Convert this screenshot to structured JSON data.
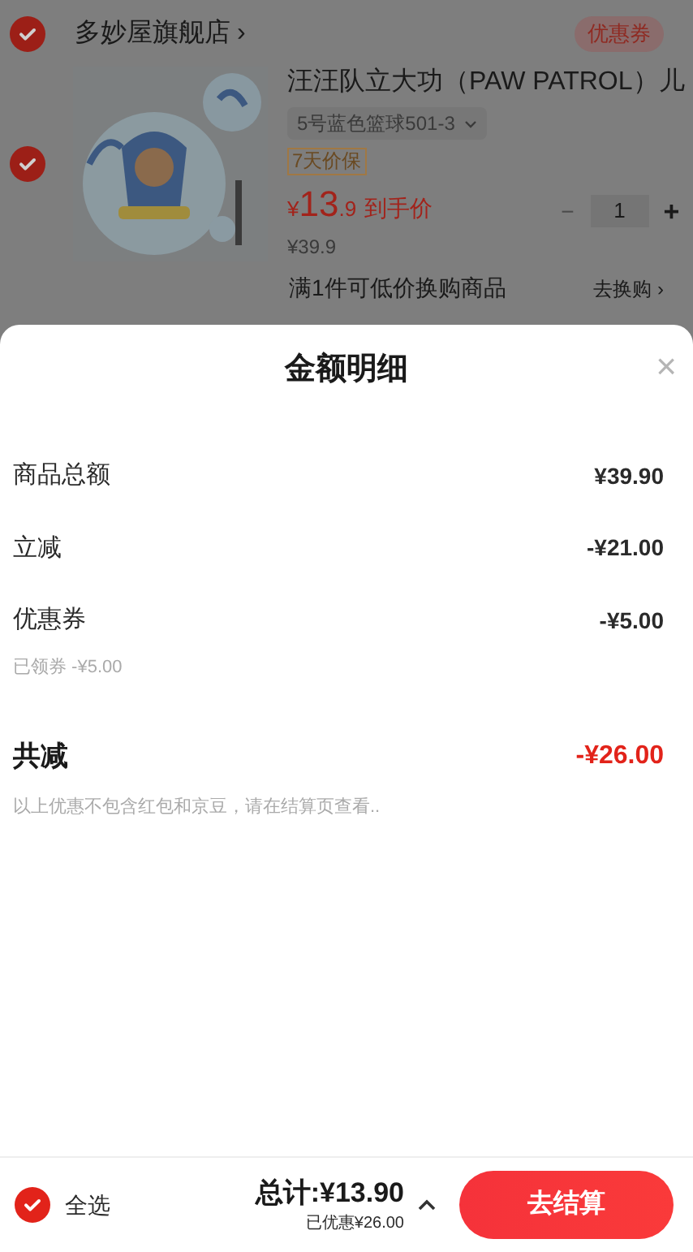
{
  "store": {
    "checked": true,
    "name": "多妙屋旗舰店",
    "chevron": "›",
    "coupon_badge": "优惠券"
  },
  "product": {
    "checked": true,
    "title": "汪汪队立大功（PAW PATROL）儿",
    "variant": "5号蓝色篮球501-3",
    "badge": "7天价保",
    "price_symbol": "¥",
    "price_int": "13",
    "price_dec": ".9",
    "price_label": "到手价",
    "original_price": "¥39.9",
    "minus": "−",
    "quantity": "1",
    "plus": "+"
  },
  "promo": {
    "text": "满1件可低价换购商品",
    "link": "去换购 ›"
  },
  "sheet": {
    "title": "金额明细",
    "close": "×",
    "rows": [
      {
        "kind": "item",
        "label": "商品总额",
        "value": "¥39.90"
      },
      {
        "kind": "item",
        "label": "立减",
        "value": "-¥21.00"
      },
      {
        "kind": "item",
        "label": "优惠券",
        "value": "-¥5.00",
        "note": "已领券 -¥5.00"
      },
      {
        "kind": "total",
        "label": "共减",
        "value": "-¥26.00"
      }
    ],
    "footnote": "以上优惠不包含红包和京豆，请在结算页查看.."
  },
  "bottom_bar": {
    "select_all": {
      "checked": true,
      "label": "全选"
    },
    "total": "总计:¥13.90",
    "saved": "已优惠¥26.00",
    "checkout": "去结算"
  }
}
